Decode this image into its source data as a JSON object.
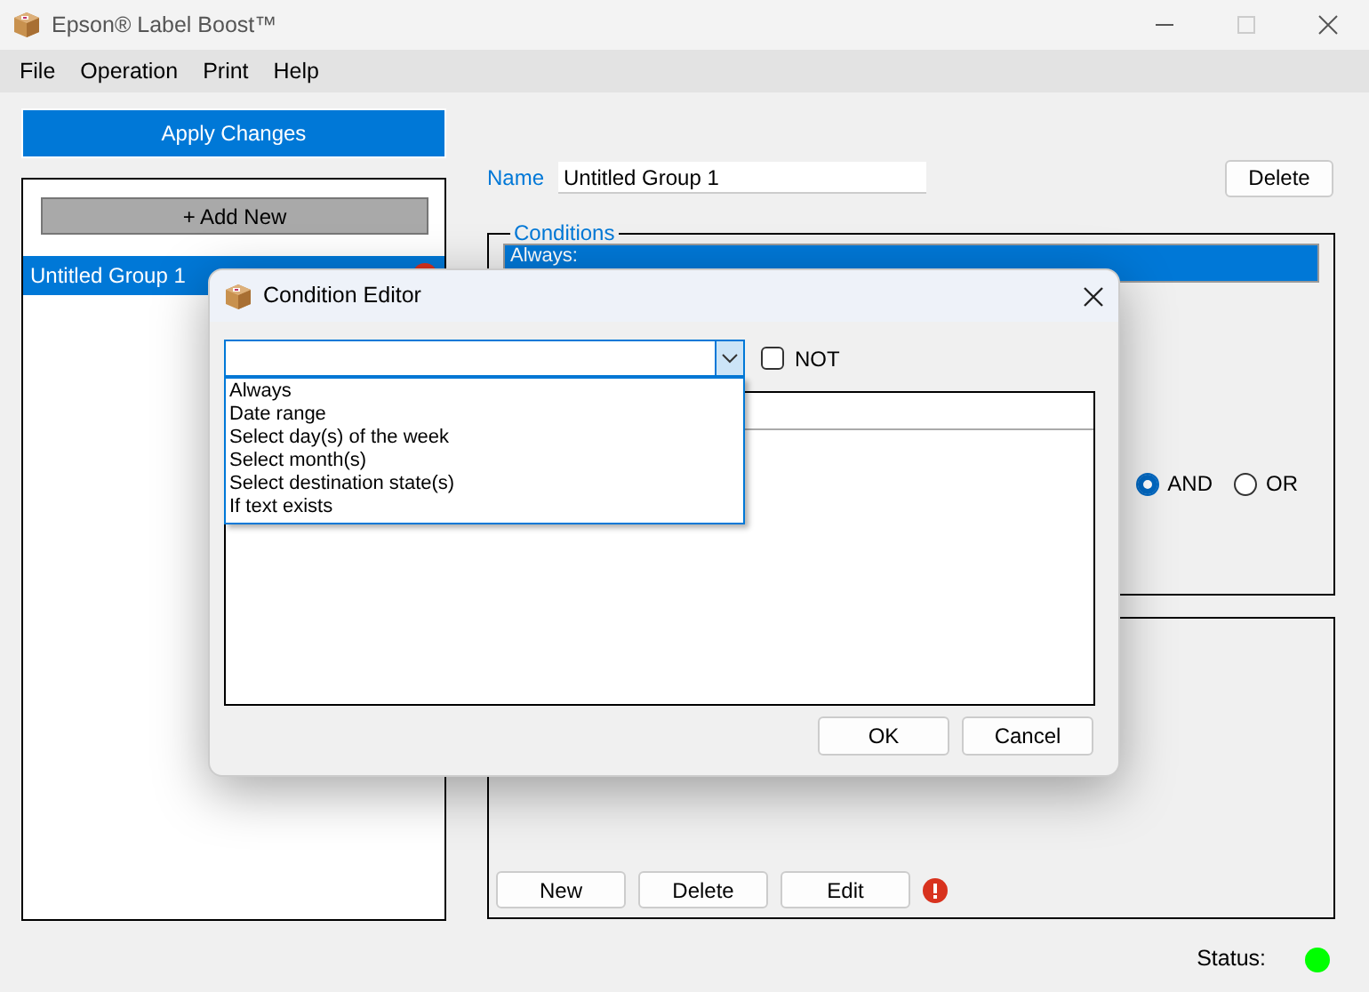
{
  "window": {
    "title": "Epson® Label Boost™"
  },
  "menu": [
    "File",
    "Operation",
    "Print",
    "Help"
  ],
  "apply_button": "Apply Changes",
  "groups_panel": {
    "add_button": "+ Add New",
    "items": [
      {
        "label": "Untitled Group 1",
        "selected": true,
        "error": true
      }
    ]
  },
  "name_field": {
    "label": "Name",
    "value": "Untitled Group 1"
  },
  "delete_button": "Delete",
  "conditions": {
    "title": "Conditions",
    "items": [
      {
        "label": "Always:",
        "selected": true
      }
    ],
    "logic": [
      {
        "label": "AND",
        "selected": true
      },
      {
        "label": "OR",
        "selected": false
      }
    ]
  },
  "actions": {
    "buttons": [
      "New",
      "Delete",
      "Edit"
    ],
    "error": true
  },
  "status": {
    "label": "Status:",
    "color": "#00ff00"
  },
  "dialog": {
    "title": "Condition Editor",
    "combo": {
      "expanded": true,
      "options": [
        "Always",
        "Date range",
        "Select day(s) of the week",
        "Select month(s)",
        "Select destination state(s)",
        "If text exists"
      ]
    },
    "not": {
      "label": "NOT",
      "checked": false
    },
    "buttons": [
      "OK",
      "Cancel"
    ]
  }
}
